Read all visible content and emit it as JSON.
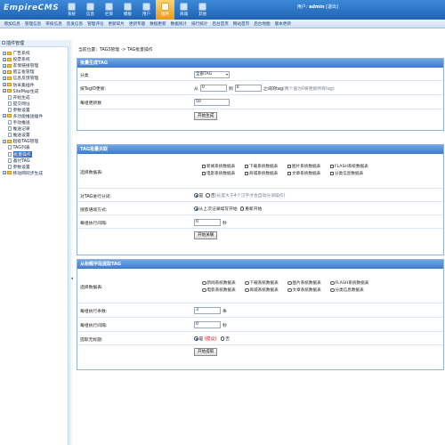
{
  "header": {
    "logo": "EmpireCMS",
    "user_prefix": "用户: ",
    "user_name": "admin",
    "logout": "[退出]",
    "tabs": [
      "系统",
      "信息",
      "栏目",
      "模板",
      "用户",
      "插件",
      "商城",
      "其他"
    ],
    "active_tab": "插件"
  },
  "subnav": [
    "增加信息",
    "管理信息",
    "审核信息",
    "签发信息",
    "管理评论",
    "更新碎片",
    "更新专题",
    "数据更新",
    "数据统计",
    "排行统计",
    "后台首页",
    "网站首页",
    "后台地图",
    "版本更新"
  ],
  "sidebar": {
    "title": "插件管理",
    "items": [
      {
        "label": "广告系统",
        "level": 0,
        "type": "folder"
      },
      {
        "label": "投票系统",
        "level": 0,
        "type": "folder"
      },
      {
        "label": "友情链接管理",
        "level": 0,
        "type": "folder"
      },
      {
        "label": "留言板管理",
        "level": 0,
        "type": "folder"
      },
      {
        "label": "信息反馈管理",
        "level": 0,
        "type": "folder"
      },
      {
        "label": "防采集插件",
        "level": 0,
        "type": "folder"
      },
      {
        "label": "SiteMap生成",
        "level": 0,
        "type": "folder"
      },
      {
        "label": "开始生成",
        "level": 1,
        "type": "doc"
      },
      {
        "label": "提交网址",
        "level": 1,
        "type": "doc"
      },
      {
        "label": "参数设置",
        "level": 1,
        "type": "doc"
      },
      {
        "label": "多功能推送插件",
        "level": 0,
        "type": "folder"
      },
      {
        "label": "手动推送",
        "level": 1,
        "type": "doc"
      },
      {
        "label": "推送记录",
        "level": 1,
        "type": "doc"
      },
      {
        "label": "推送设置",
        "level": 1,
        "type": "doc"
      },
      {
        "label": "超级TAG管理",
        "level": 0,
        "type": "folder"
      },
      {
        "label": "TAG列表",
        "level": 1,
        "type": "doc"
      },
      {
        "label": "批量操作",
        "level": 1,
        "type": "doc",
        "active": true
      },
      {
        "label": "邀付TAG",
        "level": 1,
        "type": "doc"
      },
      {
        "label": "参数设置",
        "level": 1,
        "type": "doc"
      },
      {
        "label": "移动网同步生成",
        "level": 0,
        "type": "folder"
      }
    ]
  },
  "breadcrumb": "当前位置：TAGS管理 -> TAG批量操作",
  "panel1": {
    "title": "批量生成TAG",
    "rows": {
      "category_label": "分类",
      "category_value": "全部TAG",
      "id_label": "按TagID更新:",
      "id_from_prefix": "从",
      "id_from_value": "0",
      "id_to_prefix": "到",
      "id_to_value": "0",
      "id_note": "之间的tag",
      "id_hint": "(两个值为0将更新所有tag)",
      "per_group_label": "每组更新数",
      "per_group_value": "50",
      "submit": "开始生成"
    }
  },
  "panel2": {
    "title": "TAG批量关联",
    "table_label": "选择数据表:",
    "tables": [
      "新闻系统数据表",
      "下载系统数据表",
      "图片系统数据表",
      "FLASH系统数据表",
      "电影系统数据表",
      "商城系统数据表",
      "文章系统数据表",
      "分类信息数据表"
    ],
    "split_label": "对TAG进行分词:",
    "split_yes": "是",
    "split_no": "否",
    "split_hint": "(长度大于4个汉字才会自动分词操作)",
    "search_label": "搜索语境方式:",
    "search_opt1": "从上次记录续写开始",
    "search_opt2": "重新开始",
    "interval_label": "每组执行间隔:",
    "interval_value": "0",
    "interval_unit": "秒",
    "submit": "开始关联"
  },
  "panel3": {
    "title": "从标题字段提取TAG",
    "table_label": "选择数据表:",
    "tables": [
      "新闻系统数据表",
      "下载系统数据表",
      "图片系统数据表",
      "FLASH系统数据表",
      "电影系统数据表",
      "商城系统数据表",
      "文章系统数据表",
      "分类信息数据表"
    ],
    "per_group_label": "每组执行条数:",
    "per_group_value": "3",
    "per_group_unit": "条",
    "interval_label": "每组执行间隔:",
    "interval_value": "0",
    "interval_unit": "秒",
    "skip_label": "提取无标题:",
    "skip_yes": "是",
    "skip_yes_note": "(提议)",
    "skip_no": "否",
    "submit": "开始提取"
  }
}
